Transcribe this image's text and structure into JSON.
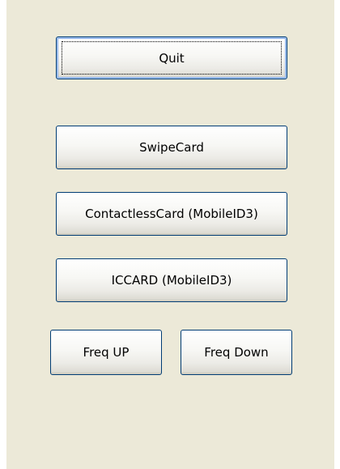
{
  "buttons": {
    "quit": "Quit",
    "swipe_card": "SwipeCard",
    "contactless_card": "ContactlessCard (MobileID3)",
    "iccard": "ICCARD (MobileID3)",
    "freq_up": "Freq UP",
    "freq_down": "Freq Down"
  },
  "colors": {
    "window_background": "#ece9d8",
    "button_border": "#003c74",
    "default_button_highlight": "#8cb0e8"
  }
}
